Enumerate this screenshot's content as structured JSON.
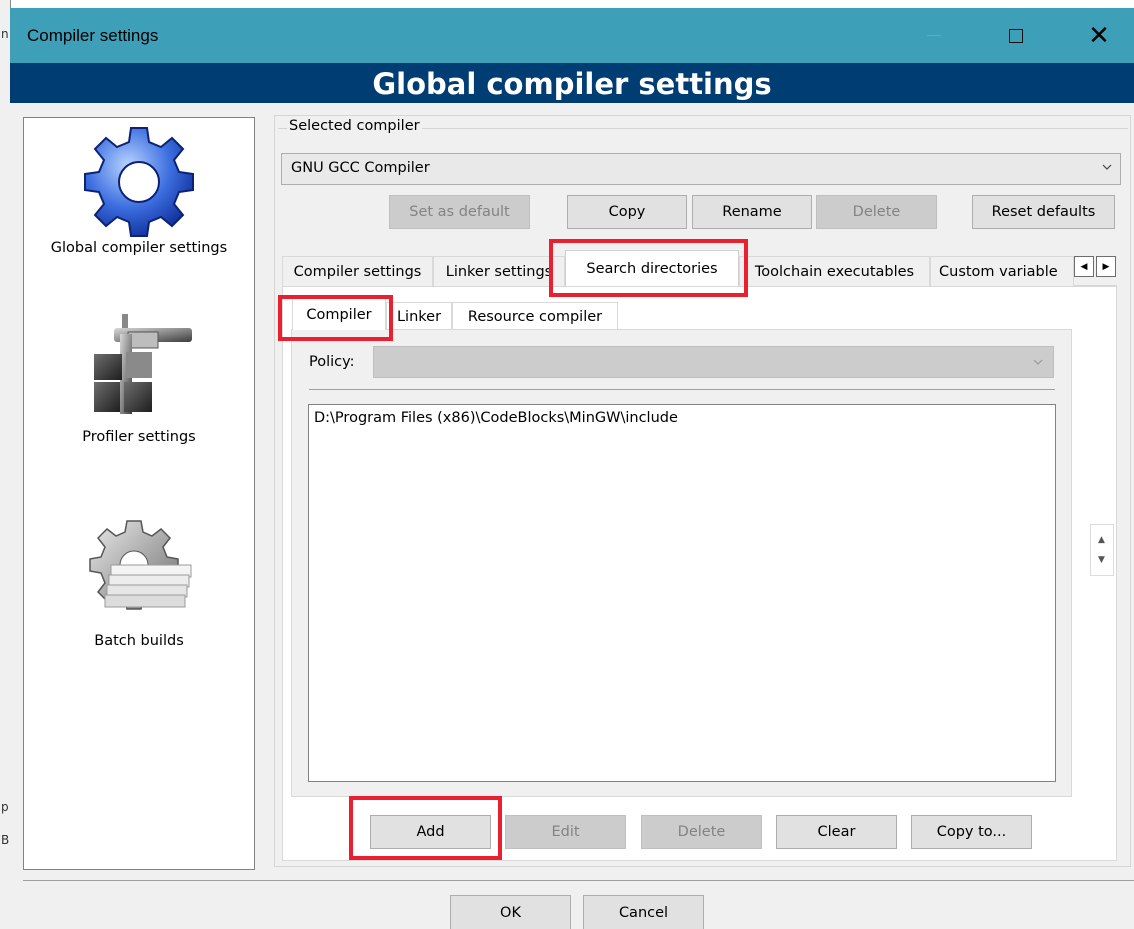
{
  "window": {
    "title": "Compiler settings"
  },
  "banner": {
    "title": "Global compiler settings"
  },
  "background_window": {
    "edge_chars": [
      "n",
      "p",
      "B"
    ]
  },
  "categories": [
    {
      "label": "Global compiler settings",
      "icon": "gear-icon"
    },
    {
      "label": "Profiler settings",
      "icon": "caliper-icon"
    },
    {
      "label": "Batch builds",
      "icon": "gear-stack-icon"
    }
  ],
  "selected_compiler": {
    "label": "Selected compiler",
    "value": "GNU GCC Compiler"
  },
  "compiler_buttons": {
    "set_default": "Set as default",
    "copy": "Copy",
    "rename": "Rename",
    "delete": "Delete",
    "reset": "Reset defaults"
  },
  "tabs": [
    "Compiler settings",
    "Linker settings",
    "Search directories",
    "Toolchain executables",
    "Custom variable"
  ],
  "active_tab": "Search directories",
  "subtabs": [
    "Compiler",
    "Linker",
    "Resource compiler"
  ],
  "active_subtab": "Compiler",
  "policy": {
    "label": "Policy:",
    "value": ""
  },
  "directories": [
    "D:\\Program Files (x86)\\CodeBlocks\\MinGW\\include"
  ],
  "dir_buttons": {
    "add": "Add",
    "edit": "Edit",
    "delete": "Delete",
    "clear": "Clear",
    "copy_to": "Copy to..."
  },
  "dialog_buttons": {
    "ok": "OK",
    "cancel": "Cancel"
  },
  "colors": {
    "titlebar": "#3e9fb8",
    "banner": "#003d73",
    "highlight": "#e8202f"
  }
}
